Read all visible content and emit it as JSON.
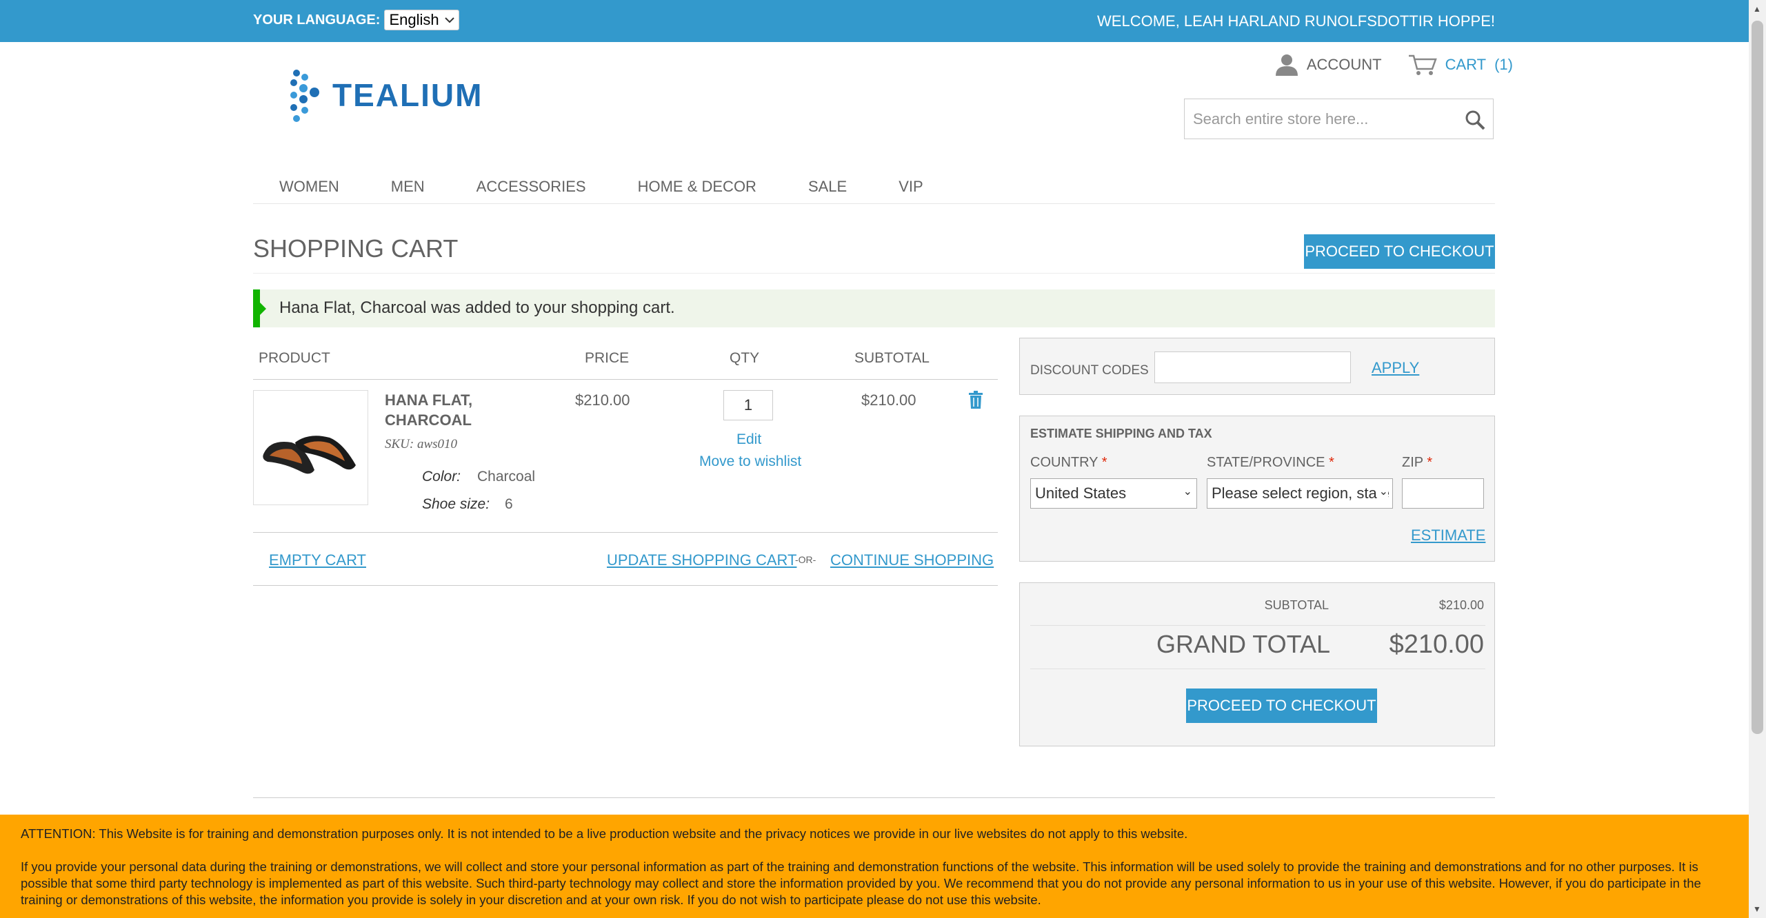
{
  "topbar": {
    "language_label": "YOUR LANGUAGE:",
    "language_value": "English",
    "welcome": "WELCOME, LEAH HARLAND RUNOLFSDOTTIR HOPPE!"
  },
  "header": {
    "logo_text": "TEALIUM",
    "account_label": "ACCOUNT",
    "cart_label": "CART",
    "cart_count": "(1)",
    "search_placeholder": "Search entire store here..."
  },
  "nav": {
    "items": [
      {
        "label": "WOMEN"
      },
      {
        "label": "MEN"
      },
      {
        "label": "ACCESSORIES"
      },
      {
        "label": "HOME & DECOR"
      },
      {
        "label": "SALE"
      },
      {
        "label": "VIP"
      }
    ]
  },
  "page": {
    "title": "SHOPPING CART",
    "proceed_checkout": "PROCEED TO CHECKOUT",
    "success_message": "Hana Flat, Charcoal was added to your shopping cart."
  },
  "cart": {
    "columns": {
      "product": "PRODUCT",
      "price": "PRICE",
      "qty": "QTY",
      "subtotal": "SUBTOTAL"
    },
    "item": {
      "name": "HANA FLAT, CHARCOAL",
      "sku": "SKU: aws010",
      "color_label": "Color:",
      "color_value": "Charcoal",
      "size_label": "Shoe size:",
      "size_value": "6",
      "price": "$210.00",
      "qty": "1",
      "subtotal": "$210.00",
      "edit": "Edit",
      "move_to_wishlist": "Move to wishlist"
    },
    "empty_cart": "EMPTY CART",
    "update_cart": "UPDATE SHOPPING CART",
    "or": "-OR-",
    "continue_shopping": "CONTINUE SHOPPING"
  },
  "discount": {
    "label": "DISCOUNT CODES",
    "apply": "APPLY"
  },
  "shipping": {
    "title": "ESTIMATE SHIPPING AND TAX",
    "country_label": "COUNTRY",
    "country_value": "United States",
    "state_label": "STATE/PROVINCE",
    "state_value": "Please select region, state or province",
    "zip_label": "ZIP",
    "required_mark": "*",
    "estimate": "ESTIMATE"
  },
  "totals": {
    "subtotal_label": "SUBTOTAL",
    "subtotal_value": "$210.00",
    "grand_total_label": "GRAND TOTAL",
    "grand_total_value": "$210.00",
    "proceed_checkout": "PROCEED TO CHECKOUT"
  },
  "notice": {
    "line1": "ATTENTION: This Website is for training and demonstration purposes only. It is not intended to be a live production website and the privacy notices we provide in our live websites do not apply to this website.",
    "line2": "If you provide your personal data during the training or demonstrations, we will collect and store your personal information as part of the training and demonstration functions of the website. This information will be used solely to provide the training and demonstrations and for no other purposes. It is possible that some third party technology is implemented as part of this website. Such third-party technology may collect and store the information provided by you. We recommend that you do not provide any personal information to us in your use of this website. However, if you do participate in the training or demonstrations of this website, the information you provide is solely in your discretion and at your own risk. If you do not wish to participate please do not use this website."
  },
  "colors": {
    "accent": "#3399cc",
    "success": "#11b400",
    "notice": "#ffa500"
  }
}
